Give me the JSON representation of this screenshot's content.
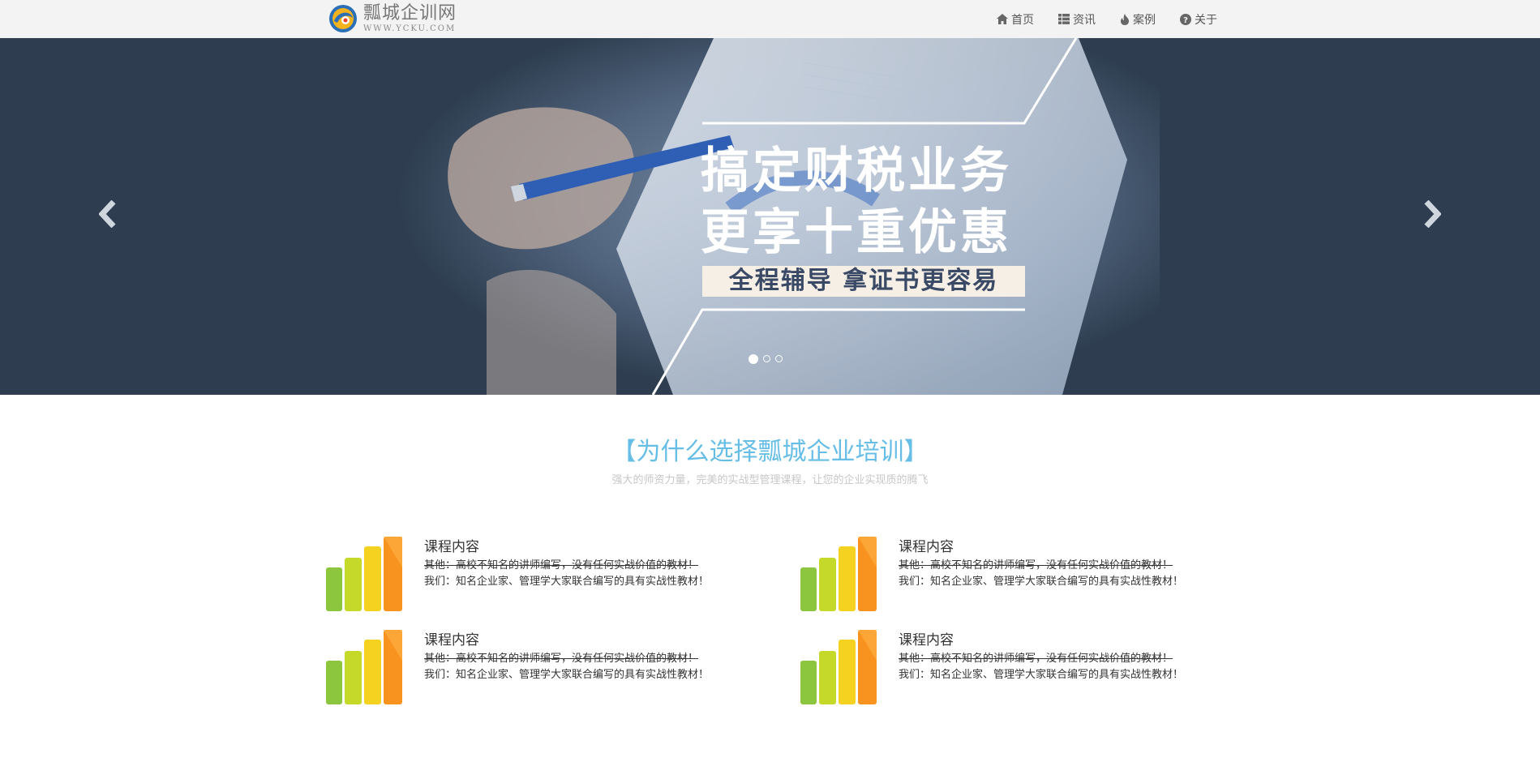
{
  "brand": {
    "name": "瓢城企训网",
    "domain": "WWW.YCKU.COM"
  },
  "nav": {
    "items": [
      {
        "label": "首页",
        "icon": "home-icon"
      },
      {
        "label": "资讯",
        "icon": "th-list-icon"
      },
      {
        "label": "案例",
        "icon": "fire-icon"
      },
      {
        "label": "关于",
        "icon": "question-circle-icon"
      }
    ]
  },
  "carousel": {
    "slogan_line1": "搞定财税业务",
    "slogan_line2": "更享十重优惠",
    "slogan_box": "全程辅导 拿证书更容易",
    "slide_count": 3,
    "active_slide": 1,
    "colors": {
      "background": "#2e3e50"
    }
  },
  "section": {
    "title": "【为什么选择瓢城企业培训】",
    "subtitle": "强大的师资力量，完美的实战型管理课程，让您的企业实现质的腾飞"
  },
  "features": [
    {
      "title": "课程内容",
      "line1": "其他：高校不知名的讲师编写，没有任何实战价值的教材！",
      "line2": "我们：知名企业家、管理学大家联合编写的具有实战性教材！"
    },
    {
      "title": "课程内容",
      "line1": "其他：高校不知名的讲师编写，没有任何实战价值的教材！",
      "line2": "我们：知名企业家、管理学大家联合编写的具有实战性教材！"
    },
    {
      "title": "课程内容",
      "line1": "其他：高校不知名的讲师编写，没有任何实战价值的教材！",
      "line2": "我们：知名企业家、管理学大家联合编写的具有实战性教材！"
    },
    {
      "title": "课程内容",
      "line1": "其他：高校不知名的讲师编写，没有任何实战价值的教材！",
      "line2": "我们：知名企业家、管理学大家联合编写的具有实战性教材！"
    }
  ],
  "colors": {
    "accent": "#66bde6",
    "navbar_bg": "#f3f3f3",
    "bar_green": "#8cc63f",
    "bar_lime": "#c5d92a",
    "bar_yellow": "#f5d21f",
    "bar_orange": "#f7931e"
  }
}
